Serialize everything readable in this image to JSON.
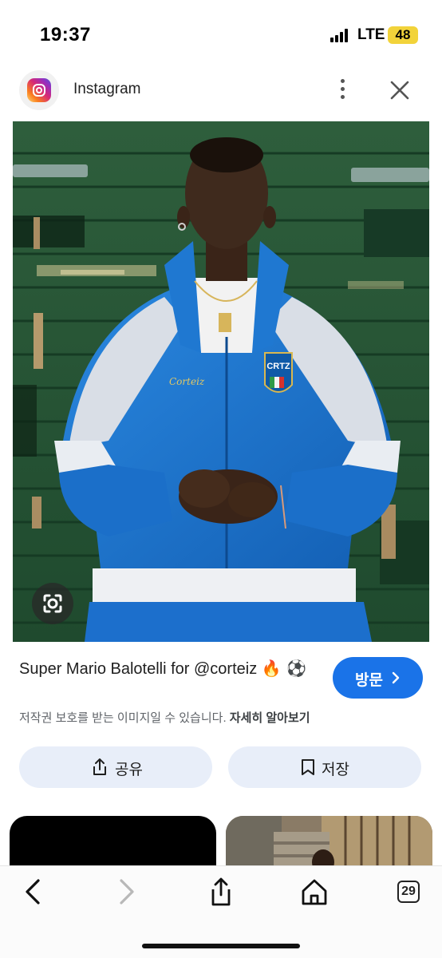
{
  "status_bar": {
    "time": "19:37",
    "network": "LTE",
    "battery": "48"
  },
  "header": {
    "app_name": "Instagram",
    "logo_icon": "instagram-logo-icon",
    "more_icon": "more-vertical-icon",
    "close_icon": "close-icon"
  },
  "main_image": {
    "lens_icon": "google-lens-icon",
    "jacket_badge_text": "CRTZ",
    "jacket_brand_script": "Corteiz"
  },
  "result": {
    "title": "Super Mario Balotelli for @corteiz",
    "title_emojis": "🔥 ⚽",
    "visit_label": "방문",
    "copyright_note": "저작권 보호를 받는 이미지일 수 있습니다.",
    "learn_more_label": "자세히 알아보기",
    "share_label": "공유",
    "save_label": "저장"
  },
  "toolbar": {
    "tabs_count": "29",
    "icons": [
      "back-icon",
      "forward-icon",
      "share-icon",
      "home-icon",
      "tabs-icon"
    ]
  },
  "colors": {
    "accent_blue": "#1a73e8",
    "chip_background": "#e8eef9",
    "battery_yellow": "#f2d33a",
    "wall_green": "#2a5a3a",
    "jacket_blue": "#1f78d1"
  }
}
